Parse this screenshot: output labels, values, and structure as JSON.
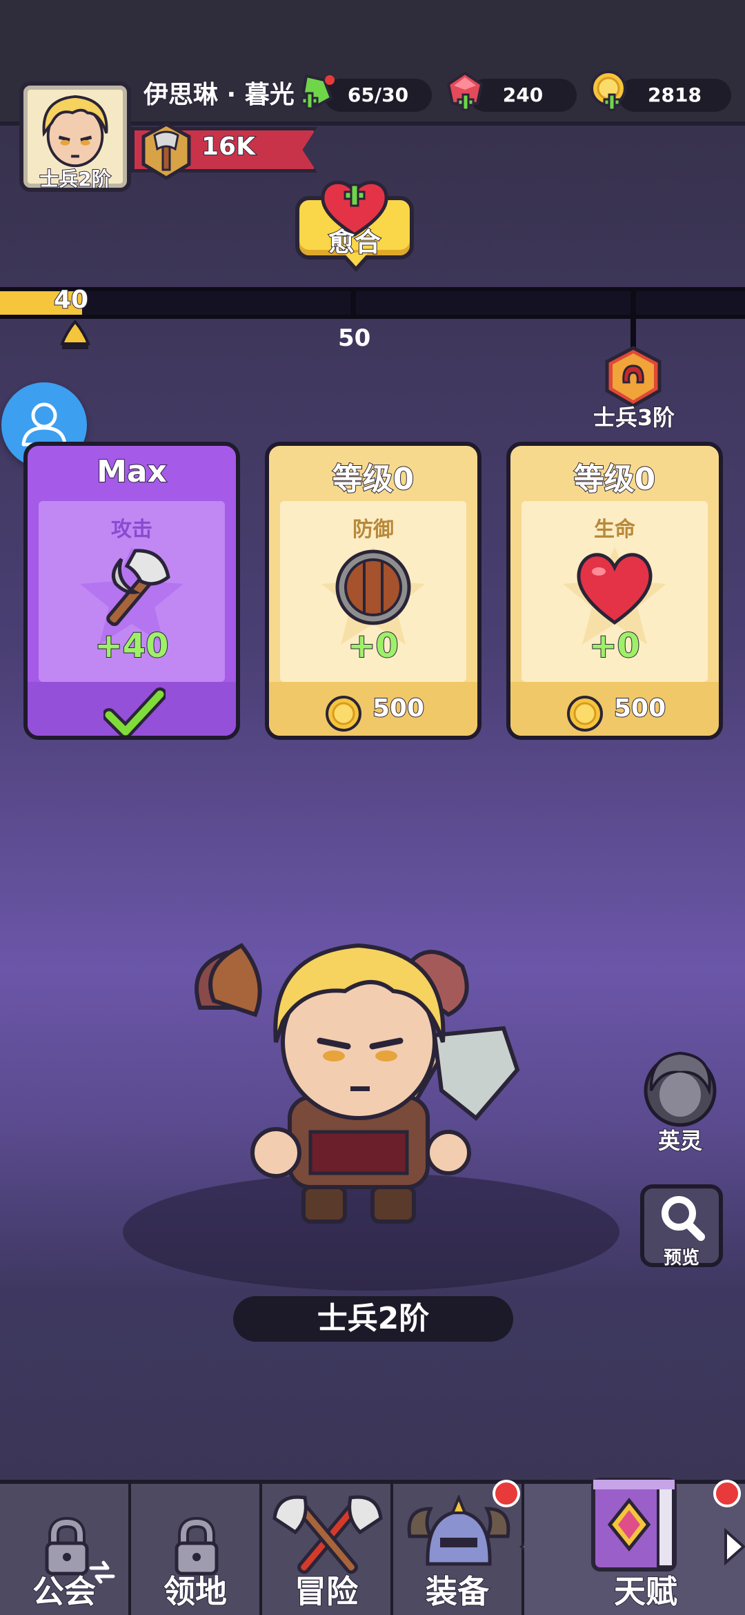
{
  "player": {
    "name": "伊思琳 · 暮光",
    "rank": "士兵2阶",
    "power": "16K"
  },
  "resources": {
    "energy": "65/30",
    "gems": "240",
    "gold": "2818"
  },
  "heal_button": {
    "label": "愈合"
  },
  "progress": {
    "current_label": "40",
    "next_label": "50",
    "fraction": 0.11,
    "next_rank": "士兵3阶"
  },
  "cards": [
    {
      "title": "Max",
      "stat": "攻击",
      "bonus": "+40",
      "status": "maxed"
    },
    {
      "title": "等级0",
      "stat": "防御",
      "bonus": "+0",
      "cost": "500"
    },
    {
      "title": "等级0",
      "stat": "生命",
      "bonus": "+0",
      "cost": "500"
    }
  ],
  "hero": {
    "name": "士兵2阶"
  },
  "side_buttons": {
    "spirit": "英灵",
    "preview": "预览"
  },
  "nav": {
    "tabs": [
      {
        "label": "公会",
        "locked": true
      },
      {
        "label": "领地",
        "locked": true
      },
      {
        "label": "冒险",
        "locked": false
      },
      {
        "label": "装备",
        "locked": false,
        "badge": true
      },
      {
        "label": "天赋",
        "locked": false,
        "active": true,
        "badge": true
      }
    ]
  },
  "colors": {
    "gold_bar": "#f5c53b",
    "purple_card": "#a55ae8",
    "gold_card": "#f7d98e",
    "bonus_green": "#9ef069"
  }
}
